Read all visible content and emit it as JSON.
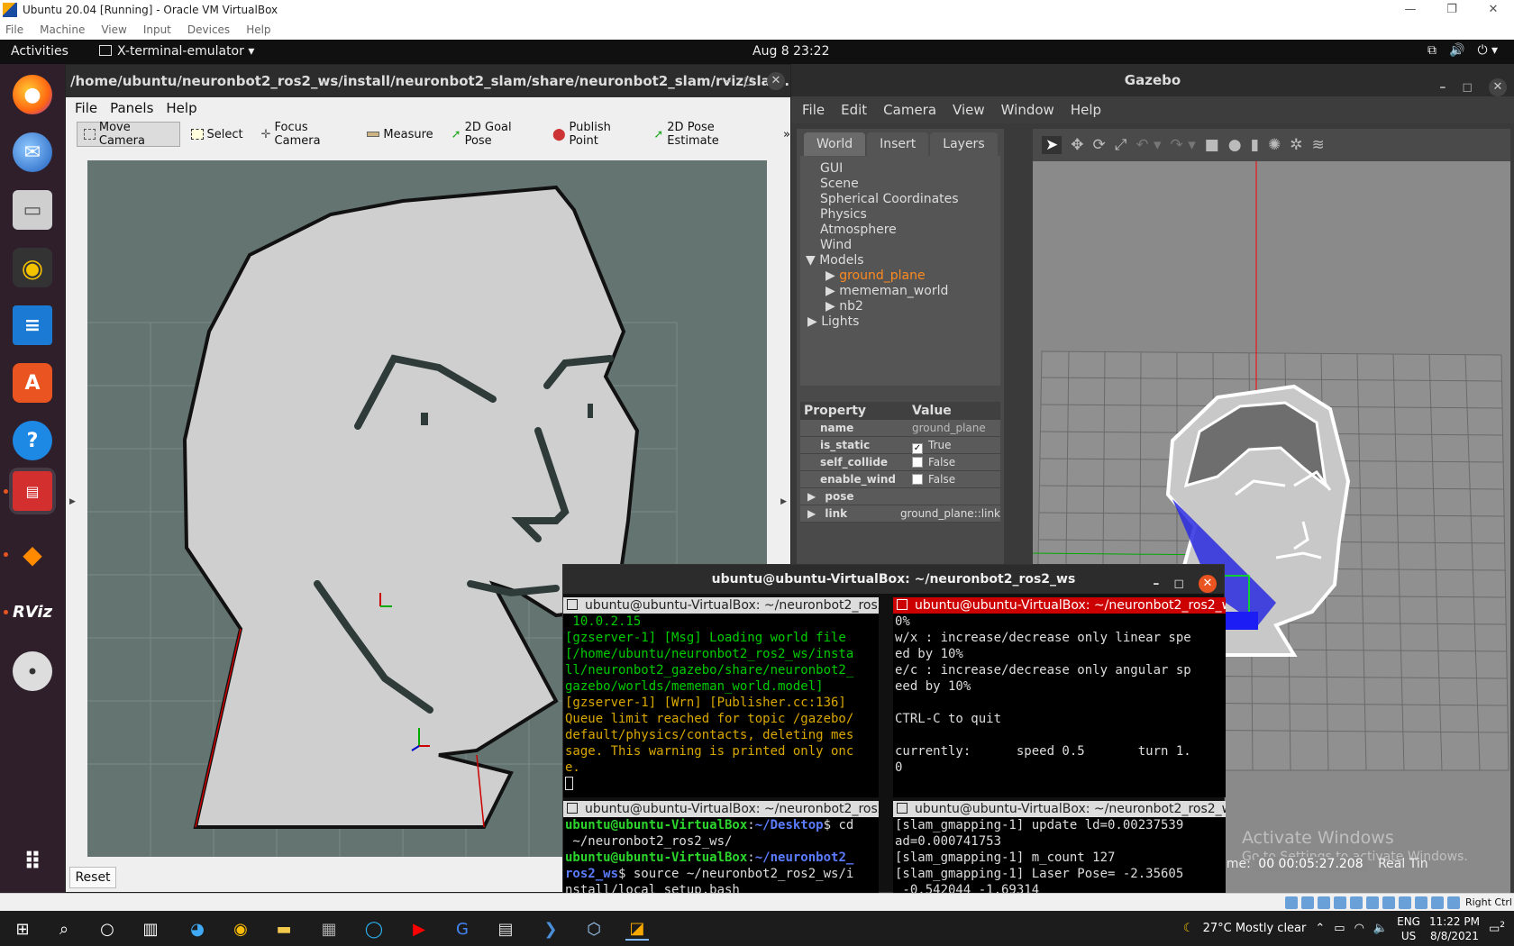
{
  "host": {
    "title": "Ubuntu 20.04 [Running] - Oracle VM VirtualBox",
    "menu": [
      "File",
      "Machine",
      "View",
      "Input",
      "Devices",
      "Help"
    ],
    "status_right": "Right Ctrl"
  },
  "gnome": {
    "activities": "Activities",
    "app": "X-terminal-emulator",
    "clock": "Aug 8  23:22"
  },
  "dock": {
    "items": [
      "firefox-icon",
      "thunderbird-icon",
      "files-icon",
      "rhythmbox-icon",
      "writer-icon",
      "software-icon",
      "help-icon",
      "terminal-icon",
      "app-icon",
      "rviz-icon",
      "dvd-icon",
      "show-apps-icon"
    ],
    "rviz_label": "RViz"
  },
  "rviz": {
    "title": "/home/ubuntu/neuronbot2_ros2_ws/install/neuronbot2_slam/share/neuronbot2_slam/rviz/slam...",
    "menu": [
      "File",
      "Panels",
      "Help"
    ],
    "tools": [
      "Move Camera",
      "Select",
      "Focus Camera",
      "Measure",
      "2D Goal Pose",
      "Publish Point",
      "2D Pose Estimate"
    ],
    "overflow": "»",
    "reset": "Reset"
  },
  "gazebo": {
    "title": "Gazebo",
    "menu": [
      "File",
      "Edit",
      "Camera",
      "View",
      "Window",
      "Help"
    ],
    "tabs": [
      "World",
      "Insert",
      "Layers"
    ],
    "tree": [
      "GUI",
      "Scene",
      "Spherical Coordinates",
      "Physics",
      "Atmosphere",
      "Wind",
      "Models",
      "ground_plane",
      "mememan_world",
      "nb2",
      "Lights"
    ],
    "props_header": [
      "Property",
      "Value"
    ],
    "props": [
      {
        "name": "name",
        "value": "ground_plane"
      },
      {
        "name": "is_static",
        "value": "True"
      },
      {
        "name": "self_collide",
        "value": "False"
      },
      {
        "name": "enable_wind",
        "value": "False"
      },
      {
        "name": "pose",
        "value": ""
      },
      {
        "name": "link",
        "value": "ground_plane::link"
      }
    ],
    "sim_time_label": "Sim Time:",
    "sim_time_value": "00 00:05:27.208",
    "real_time_label": "Real Tin",
    "activate_1": "Activate Windows",
    "activate_2": "Go to Settings to activate Windows."
  },
  "terminal": {
    "title": "ubuntu@ubuntu-VirtualBox: ~/neuronbot2_ros2_ws",
    "pane_title": "ubuntu@ubuntu-VirtualBox: ~/neuronbot2_ros2_ws",
    "tl_lines": [
      {
        "c": "t-green",
        "t": " 10.0.2.15"
      },
      {
        "c": "t-green",
        "t": "[gzserver-1] [Msg] Loading world file"
      },
      {
        "c": "t-green",
        "t": "[/home/ubuntu/neuronbot2_ros2_ws/insta"
      },
      {
        "c": "t-green",
        "t": "ll/neuronbot2_gazebo/share/neuronbot2_"
      },
      {
        "c": "t-green",
        "t": "gazebo/worlds/mememan_world.model]"
      },
      {
        "c": "t-yellow",
        "t": "[gzserver-1] [Wrn] [Publisher.cc:136]"
      },
      {
        "c": "t-yellow",
        "t": "Queue limit reached for topic /gazebo/"
      },
      {
        "c": "t-yellow",
        "t": "default/physics/contacts, deleting mes"
      },
      {
        "c": "t-yellow",
        "t": "sage. This warning is printed only onc"
      },
      {
        "c": "t-yellow",
        "t": "e."
      }
    ],
    "tr_lines": [
      "0%",
      "w/x : increase/decrease only linear spe",
      "ed by 10%",
      "e/c : increase/decrease only angular sp",
      "eed by 10%",
      "",
      "CTRL-C to quit",
      "",
      "currently:      speed 0.5       turn 1.",
      "0"
    ],
    "bl": {
      "prompt_user": "ubuntu@ubuntu-VirtualBox",
      "path1": "~/Desktop",
      "cmd1": "$ cd",
      "cmd1b": " ~/neuronbot2_ros2_ws/",
      "path2": "~/neuronbot2_",
      "path2b": "ros2_ws",
      "cmd2": "$ source ~/neuronbot2_ros2_ws/i",
      "cmd2b": "nstall/local_setup.bash"
    },
    "br_lines": [
      "[slam_gmapping-1] update ld=0.00237539",
      "ad=0.000741753",
      "[slam_gmapping-1] m_count 127",
      "[slam_gmapping-1] Laser Pose= -2.35605",
      " -0.542044 -1.69314"
    ]
  },
  "taskbar": {
    "weather": "27°C  Mostly clear",
    "lang1": "ENG",
    "lang2": "US",
    "time": "11:22 PM",
    "date": "8/8/2021",
    "notif": "2"
  }
}
